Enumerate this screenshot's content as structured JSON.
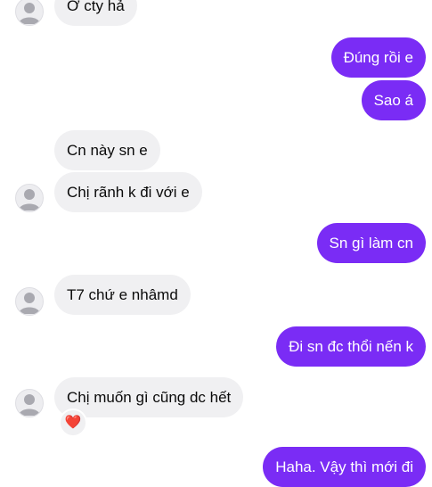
{
  "colors": {
    "outgoing_bubble": "#7a2cf5",
    "incoming_bubble": "#f0f0f2",
    "heart_reaction": "#d02c3d"
  },
  "avatar_icon": "default-person-avatar-icon",
  "messages": {
    "m1": "Ở cty hả",
    "m2": "Đúng rồi e",
    "m3": "Sao á",
    "m4": "Cn này sn e",
    "m5": "Chị rãnh k đi với e",
    "m6": "Sn gì làm cn",
    "m7": "T7 chứ e nhâmd",
    "m8": "Đi sn đc thổi nến k",
    "m9": "Chị muốn gì cũng dc hết",
    "m10": "Haha. Vậy thì mới đi"
  },
  "reactions": {
    "m9": "❤️"
  }
}
